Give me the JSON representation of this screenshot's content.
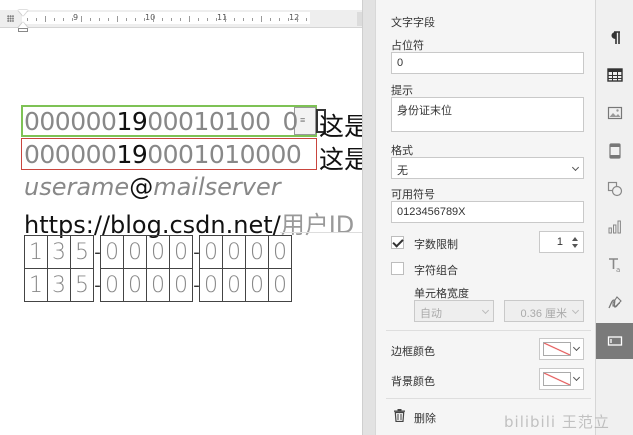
{
  "ruler": {
    "labels": [
      "9",
      "10",
      "11",
      "12"
    ]
  },
  "document": {
    "line1": {
      "prefix": "000000",
      "mid": "19",
      "suffix": "00010100",
      "caret_char": "0",
      "tail": "这是"
    },
    "line2": {
      "prefix": "000000",
      "mid": "19",
      "suffix": "0001010000",
      "tail": "这是"
    },
    "line3": {
      "user": "userame",
      "at": "@",
      "server": "mailserver"
    },
    "line4": {
      "url": "https://blog.csdn.net/",
      "placeholder": "用户ID"
    },
    "digit_groups": [
      [
        "1",
        "3",
        "5"
      ],
      [
        "0",
        "0",
        "0",
        "0"
      ],
      [
        "0",
        "0",
        "0",
        "0"
      ]
    ],
    "dash": "-"
  },
  "panel": {
    "title": "文字字段",
    "placeholder_label": "占位符",
    "placeholder_value": "0",
    "hint_label": "提示",
    "hint_value": "身份证末位",
    "format_label": "格式",
    "format_value": "无",
    "allowed_label": "可用符号",
    "allowed_value": "0123456789X",
    "char_limit_label": "字数限制",
    "char_limit_checked": true,
    "char_limit_value": "1",
    "char_combine_label": "字符组合",
    "char_combine_checked": false,
    "cell_width_label": "单元格宽度",
    "cell_width_mode": "自动",
    "cell_width_value": "0.36 厘米",
    "border_color_label": "边框颜色",
    "bg_color_label": "背景颜色",
    "delete_label": "删除"
  },
  "toolbar": {
    "icons": [
      "paragraph-icon",
      "table-icon",
      "image-icon",
      "page-icon",
      "shape-icon",
      "chart-icon",
      "text-art-icon",
      "signature-icon",
      "form-field-icon"
    ],
    "active": "form-field-icon"
  },
  "watermark": "bilibili 王范立"
}
